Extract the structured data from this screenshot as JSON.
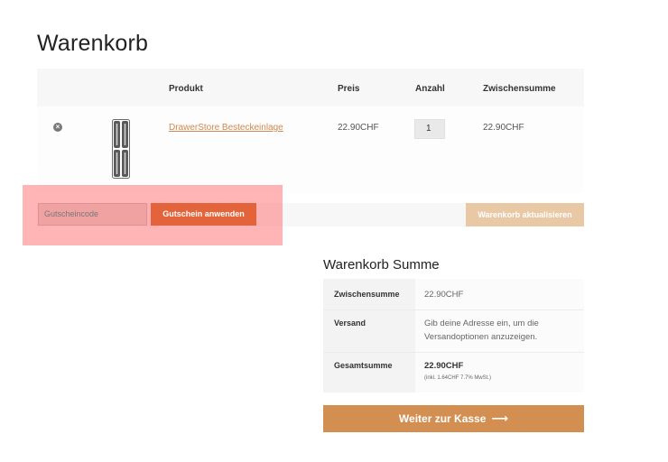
{
  "page": {
    "title": "Warenkorb"
  },
  "cart": {
    "headers": {
      "product": "Produkt",
      "price": "Preis",
      "quantity": "Anzahl",
      "subtotal": "Zwischensumme"
    },
    "items": [
      {
        "name": "DrawerStore Besteckeinlage",
        "price": "22.90CHF",
        "quantity": "1",
        "subtotal": "22.90CHF"
      }
    ],
    "remove_icon": "close-circle-icon"
  },
  "coupon": {
    "placeholder": "Gutscheincode",
    "apply_label": "Gutschein anwenden"
  },
  "update_label": "Warenkorb aktualisieren",
  "totals": {
    "title": "Warenkorb Summe",
    "subtotal_label": "Zwischensumme",
    "subtotal_value": "22.90CHF",
    "shipping_label": "Versand",
    "shipping_line1": "Gib deine Adresse ein, um die",
    "shipping_line2": "Versandoptionen anzuzeigen.",
    "total_label": "Gesamtsumme",
    "total_value": "22.90CHF",
    "tax_note": "(inkl. 1.64CHF 7.7% MwSt.)"
  },
  "checkout_label": "Weiter zur Kasse",
  "colors": {
    "accent": "#d38f52",
    "coupon_button": "#e3633a",
    "link": "#d0894f",
    "highlight": "#ff7878"
  }
}
